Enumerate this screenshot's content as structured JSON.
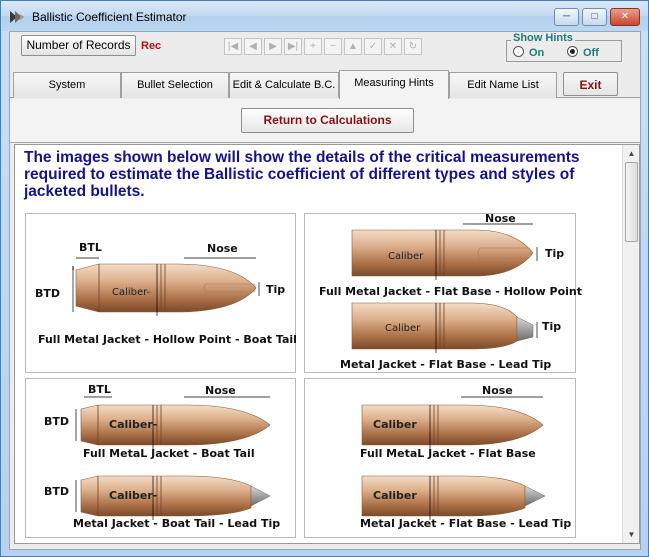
{
  "window": {
    "title": "Ballistic Coefficient Estimator"
  },
  "toolbar": {
    "records_label": "Number of Records",
    "rec_label": "Rec",
    "show_hints": {
      "legend": "Show Hints",
      "on": "On",
      "off": "Off",
      "selected": "Off"
    }
  },
  "tabs": [
    {
      "label": "System",
      "active": false
    },
    {
      "label": "Bullet Selection",
      "active": false
    },
    {
      "label": "Edit & Calculate B.C.",
      "active": false
    },
    {
      "label": "Measuring Hints",
      "active": true
    },
    {
      "label": "Edit Name List",
      "active": false
    },
    {
      "label": "Exit",
      "active": false
    }
  ],
  "return_button": "Return to Calculations",
  "intro_text": "The images shown below will show the details of the critical measurements required to estimate the Ballistic coefficient of different types and styles of jacketed bullets.",
  "labels": {
    "btl": "BTL",
    "btd": "BTD",
    "nose": "Nose",
    "tip": "Tip",
    "caliber": "Caliber",
    "caliber_dash": "Caliber-"
  },
  "captions": {
    "fmj_hp_bt": "Full Metal Jacket - Hollow Point - Boat Tail",
    "fmj_fb_hp": "Full Metal Jacket - Flat Base - Hollow Point",
    "mj_fb_lt": "Metal Jacket - Flat Base  - Lead Tip",
    "fmj_bt": "Full MetaL Jacket - Boat Tail",
    "fmj_fb": "Full MetaL Jacket -  Flat Base",
    "mj_bt_lt": "Metal Jacket - Boat Tail - Lead Tip",
    "mj_fb_lt2": "Metal Jacket - Flat Base - Lead Tip"
  },
  "colors": {
    "copper_light": "#e9c7a8",
    "copper_dark": "#8e5a36",
    "intro": "#14138a",
    "accent": "#8c1010",
    "hint": "#1f7a7a"
  }
}
